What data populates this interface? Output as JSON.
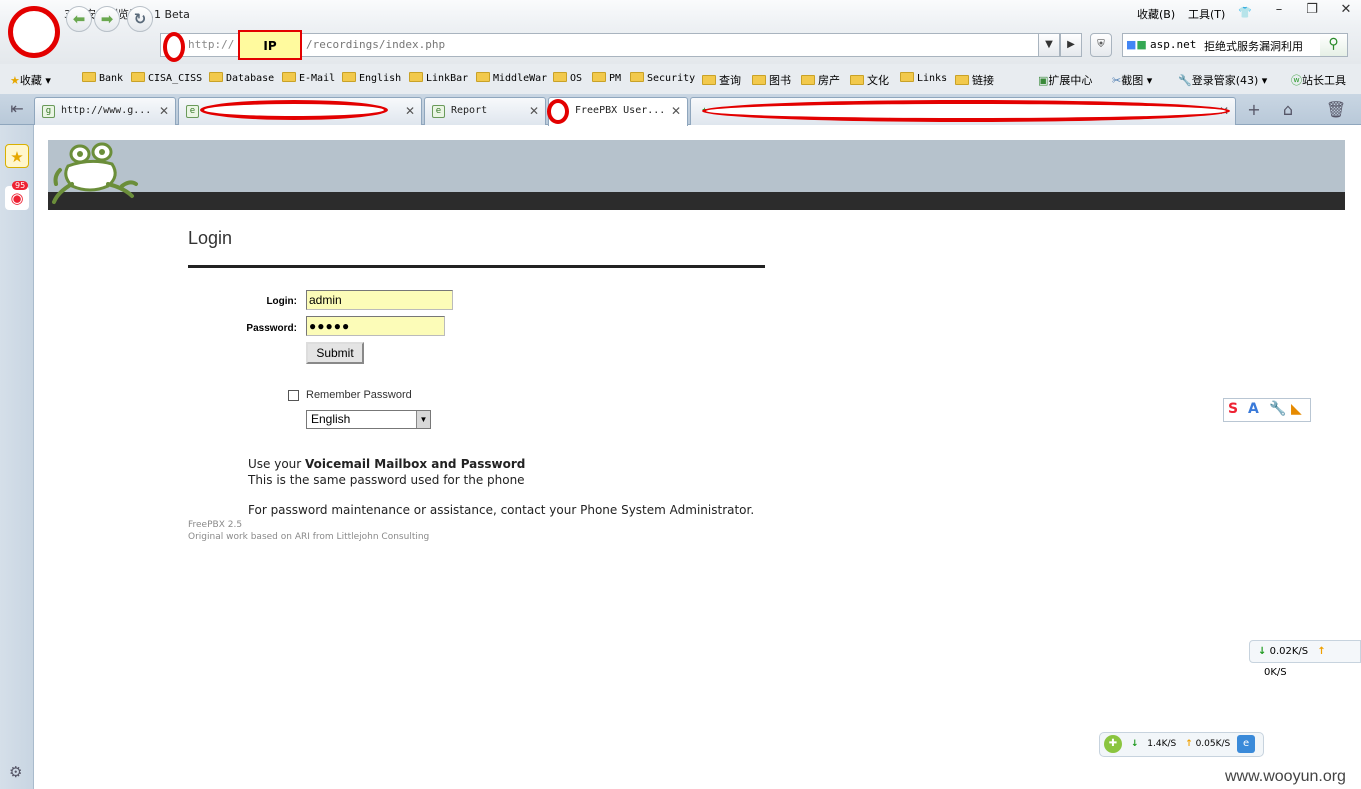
{
  "browser": {
    "title": "360安全浏览器 5.1 Beta",
    "menu_favorites": "收藏(B)",
    "menu_tools": "工具(T)",
    "address": {
      "prefix": "http://",
      "ip_label": "IP",
      "path": "/recordings/index.php"
    },
    "search": {
      "engine_label": "asp.net",
      "query": "拒绝式服务漏洞利用"
    },
    "bookmarks": {
      "favorites_label": "收藏",
      "items": [
        "Bank",
        "CISA_CISS",
        "Database",
        "E-Mail",
        "English",
        "LinkBar",
        "MiddleWar",
        "OS",
        "PM",
        "Security",
        "查询",
        "图书",
        "房产",
        "文化",
        "Links",
        "链接"
      ],
      "extensions_label": "扩展中心",
      "screenshot_label": "截图",
      "login_manager_label": "登录管家(43)",
      "webmaster_label": "站长工具"
    },
    "tabs": [
      {
        "label": "http://www.g...",
        "active": false
      },
      {
        "label": "",
        "active": false
      },
      {
        "label": "Report",
        "active": false
      },
      {
        "label": "FreePBX User...",
        "active": true
      },
      {
        "label": "",
        "active": false
      }
    ],
    "sidebar": {
      "weibo_badge": "95"
    }
  },
  "page": {
    "login_title": "Login",
    "login_label": "Login:",
    "login_value": "admin",
    "password_label": "Password:",
    "password_value": "●●●●●",
    "submit_label": "Submit",
    "remember_label": "Remember Password",
    "language_selected": "English",
    "info": {
      "line1_prefix": "Use your ",
      "line1_bold": "Voicemail Mailbox and Password",
      "line2": "This is the same password used for the phone",
      "line3": "For password maintenance or assistance, contact your Phone System Administrator."
    },
    "footer": {
      "version": "FreePBX 2.5",
      "credit": "Original work based on ARI from Littlejohn Consulting"
    }
  },
  "overlays": {
    "speed_widget_1": {
      "down": "0.02K/S",
      "up": "0K/S"
    },
    "speed_widget_2": {
      "down": "1.4K/S",
      "up": "0.05K/S"
    },
    "watermark": "www.wooyun.org"
  },
  "colors": {
    "redaction": "#e30000",
    "header_gray": "#b6c2cc",
    "header_bar": "#2c2c2c",
    "input_yellow": "#fcfcb8"
  }
}
